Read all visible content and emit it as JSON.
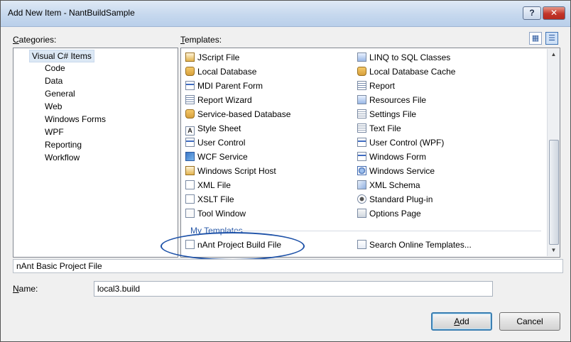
{
  "window": {
    "title": "Add New Item - NantBuildSample",
    "help_label": "?",
    "close_label": "✕"
  },
  "categories": {
    "label_prefix": "C",
    "label_rest": "ategories:",
    "items": [
      {
        "label": "Visual C# Items",
        "selected": true
      },
      {
        "label": "Code"
      },
      {
        "label": "Data"
      },
      {
        "label": "General"
      },
      {
        "label": "Web"
      },
      {
        "label": "Windows Forms"
      },
      {
        "label": "WPF"
      },
      {
        "label": "Reporting"
      },
      {
        "label": "Workflow"
      }
    ]
  },
  "templates": {
    "label_prefix": "T",
    "label_rest": "emplates:",
    "left": [
      {
        "label": "JScript File",
        "icon": "script-icon"
      },
      {
        "label": "Local Database",
        "icon": "database-icon"
      },
      {
        "label": "MDI Parent Form",
        "icon": "form-icon"
      },
      {
        "label": "Report Wizard",
        "icon": "report-wizard-icon"
      },
      {
        "label": "Service-based Database",
        "icon": "database-icon"
      },
      {
        "label": "Style Sheet",
        "icon": "stylesheet-icon"
      },
      {
        "label": "User Control",
        "icon": "user-control-icon"
      },
      {
        "label": "WCF Service",
        "icon": "wcf-service-icon"
      },
      {
        "label": "Windows Script Host",
        "icon": "script-host-icon"
      },
      {
        "label": "XML File",
        "icon": "xml-file-icon"
      },
      {
        "label": "XSLT File",
        "icon": "xslt-file-icon"
      },
      {
        "label": "Tool Window",
        "icon": "tool-window-icon"
      }
    ],
    "right": [
      {
        "label": "LINQ to SQL Classes",
        "icon": "linq-icon"
      },
      {
        "label": "Local Database Cache",
        "icon": "database-cache-icon"
      },
      {
        "label": "Report",
        "icon": "report-icon"
      },
      {
        "label": "Resources File",
        "icon": "resources-icon"
      },
      {
        "label": "Settings File",
        "icon": "settings-icon"
      },
      {
        "label": "Text File",
        "icon": "text-file-icon"
      },
      {
        "label": "User Control (WPF)",
        "icon": "user-control-wpf-icon"
      },
      {
        "label": "Windows Form",
        "icon": "windows-form-icon"
      },
      {
        "label": "Windows Service",
        "icon": "windows-service-icon"
      },
      {
        "label": "XML Schema",
        "icon": "xml-schema-icon"
      },
      {
        "label": "Standard Plug-in",
        "icon": "plugin-icon"
      },
      {
        "label": "Options Page",
        "icon": "options-page-icon"
      }
    ],
    "my_templates_label": "My Templates",
    "my_templates": [
      {
        "label": "nAnt Project Build File",
        "icon": "build-file-icon"
      }
    ],
    "search_online_label": "Search Online Templates..."
  },
  "description": "nAnt Basic Project File",
  "name_field": {
    "label_prefix": "N",
    "label_rest": "ame:",
    "value": "local3.build"
  },
  "buttons": {
    "add_prefix": "A",
    "add_rest": "dd",
    "cancel": "Cancel"
  }
}
